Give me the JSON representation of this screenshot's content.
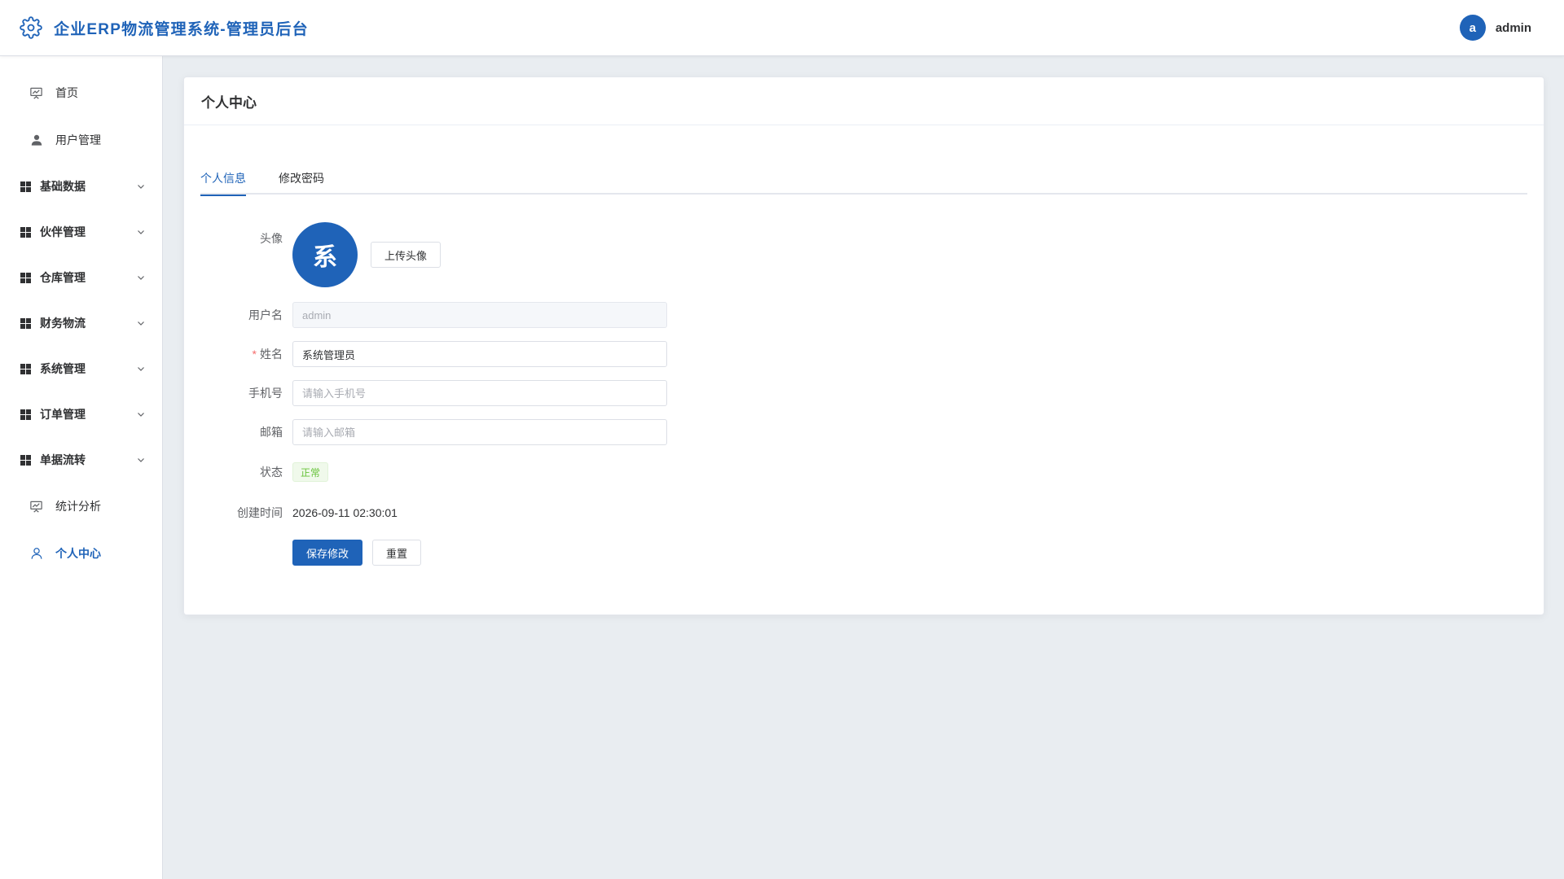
{
  "app": {
    "title": "企业ERP物流管理系统-管理员后台",
    "icon": "gear-icon",
    "brand_color": "#1f63b8"
  },
  "user": {
    "avatar_letter": "a",
    "name": "admin"
  },
  "sidebar": {
    "items": [
      {
        "label": "首页",
        "icon": "dashboard-icon",
        "type": "item"
      },
      {
        "label": "用户管理",
        "icon": "user-icon",
        "type": "item"
      },
      {
        "label": "基础数据",
        "icon": "grid-icon",
        "type": "submenu"
      },
      {
        "label": "伙伴管理",
        "icon": "grid-icon",
        "type": "submenu"
      },
      {
        "label": "仓库管理",
        "icon": "grid-icon",
        "type": "submenu"
      },
      {
        "label": "财务物流",
        "icon": "grid-icon",
        "type": "submenu"
      },
      {
        "label": "系统管理",
        "icon": "grid-icon",
        "type": "submenu"
      },
      {
        "label": "订单管理",
        "icon": "grid-icon",
        "type": "submenu"
      },
      {
        "label": "单据流转",
        "icon": "grid-icon",
        "type": "submenu"
      },
      {
        "label": "统计分析",
        "icon": "presentation-icon",
        "type": "item"
      },
      {
        "label": "个人中心",
        "icon": "user-outline-icon",
        "type": "item",
        "active": true
      }
    ]
  },
  "page": {
    "title": "个人中心",
    "tabs": [
      {
        "label": "个人信息",
        "active": true
      },
      {
        "label": "修改密码",
        "active": false
      }
    ]
  },
  "form": {
    "avatar_label": "头像",
    "avatar_char": "系",
    "upload_label": "上传头像",
    "username_label": "用户名",
    "username_value": "admin",
    "name_label": "姓名",
    "name_required_mark": "*",
    "name_value": "系统管理员",
    "phone_label": "手机号",
    "phone_placeholder": "请输入手机号",
    "email_label": "邮箱",
    "email_placeholder": "请输入邮箱",
    "status_label": "状态",
    "status_value": "正常",
    "created_label": "创建时间",
    "created_value": "2026-09-11 02:30:01",
    "save_label": "保存修改",
    "reset_label": "重置"
  }
}
